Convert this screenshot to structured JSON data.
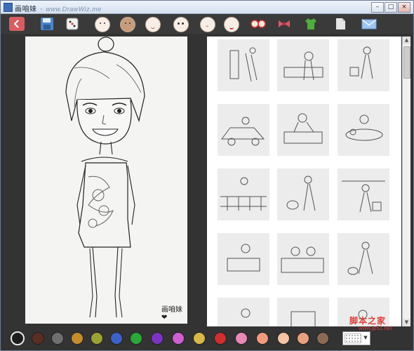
{
  "window": {
    "title": "画咱妹",
    "title_watermark": "~ www.DrawWiz.me",
    "minimize": "–",
    "maximize": "□",
    "close": "×"
  },
  "toolbar": {
    "items": [
      {
        "name": "back-button",
        "icon": "back-arrow-icon"
      },
      {
        "name": "save-button",
        "icon": "floppy-disk-icon"
      },
      {
        "name": "random-button",
        "icon": "dice-icon"
      },
      {
        "name": "face-shape-button",
        "icon": "face-outline-icon"
      },
      {
        "name": "hair-button",
        "icon": "hair-icon"
      },
      {
        "name": "eyebrows-button",
        "icon": "eyebrows-icon"
      },
      {
        "name": "eyes-button",
        "icon": "eyes-icon"
      },
      {
        "name": "nose-button",
        "icon": "nose-icon"
      },
      {
        "name": "mouth-button",
        "icon": "mouth-icon"
      },
      {
        "name": "glasses-button",
        "icon": "glasses-icon"
      },
      {
        "name": "bow-button",
        "icon": "bow-tie-icon"
      },
      {
        "name": "clothes-button",
        "icon": "shirt-icon"
      },
      {
        "name": "background-button",
        "icon": "page-icon"
      },
      {
        "name": "share-button",
        "icon": "envelope-icon"
      }
    ]
  },
  "canvas": {
    "signature": "画咱妹 ❤"
  },
  "gallery": {
    "thumbnails": [
      "room-scene",
      "cooking-scene",
      "shopping-scene",
      "car-scene",
      "sofa-scene",
      "dining-scene",
      "balcony-scene",
      "dog-walk-scene",
      "laundry-scene",
      "pet-scene",
      "bed-scene",
      "cat-scene",
      "partial-1",
      "partial-2",
      "partial-3"
    ]
  },
  "palette": {
    "colors": [
      "#1d1d1d",
      "#5a2e22",
      "#6f6f6f",
      "#c58c2b",
      "#9aa234",
      "#3d61c7",
      "#2aa83a",
      "#7b34c2",
      "#cf5fd0",
      "#d8b84a",
      "#cf2f2f",
      "#e889b5",
      "#f29a7d",
      "#f4c3a6",
      "#e9a07e",
      "#8b6a55"
    ],
    "selected_index": 0
  },
  "watermark": {
    "text": "脚本之家",
    "url": "www.jb51.net"
  },
  "colors": {
    "toolbar_bg": "#3a3a3a",
    "panel_bg": "#333333",
    "accent": "#d75d63"
  }
}
